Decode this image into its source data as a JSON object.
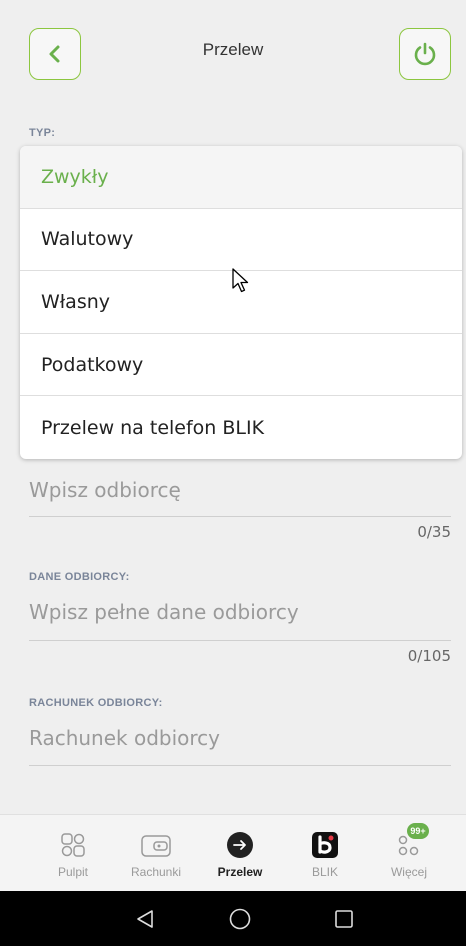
{
  "header": {
    "title": "Przelew",
    "back_icon": "chevron-left-icon",
    "power_icon": "power-icon"
  },
  "type_section": {
    "label": "TYP:",
    "options": [
      {
        "label": "Zwykły",
        "selected": true
      },
      {
        "label": "Walutowy",
        "selected": false
      },
      {
        "label": "Własny",
        "selected": false
      },
      {
        "label": "Podatkowy",
        "selected": false
      },
      {
        "label": "Przelew na telefon BLIK",
        "selected": false
      }
    ]
  },
  "recipient": {
    "placeholder": "Wpisz odbiorcę",
    "counter": "0/35"
  },
  "recipient_details": {
    "label": "DANE ODBIORCY:",
    "placeholder": "Wpisz pełne dane odbiorcy",
    "counter": "0/105"
  },
  "recipient_account": {
    "label": "RACHUNEK ODBIORCY:",
    "placeholder": "Rachunek odbiorcy"
  },
  "tabs": [
    {
      "label": "Pulpit",
      "icon": "dashboard-icon",
      "active": false
    },
    {
      "label": "Rachunki",
      "icon": "wallet-icon",
      "active": false
    },
    {
      "label": "Przelew",
      "icon": "arrow-right-circle-icon",
      "active": true
    },
    {
      "label": "BLIK",
      "icon": "blik-icon",
      "active": false
    },
    {
      "label": "Więcej",
      "icon": "more-icon",
      "active": false,
      "badge": "99+"
    }
  ],
  "colors": {
    "accent": "#6ab04c",
    "background": "#efefef",
    "label": "#7a8599",
    "navbar": "#000000"
  }
}
